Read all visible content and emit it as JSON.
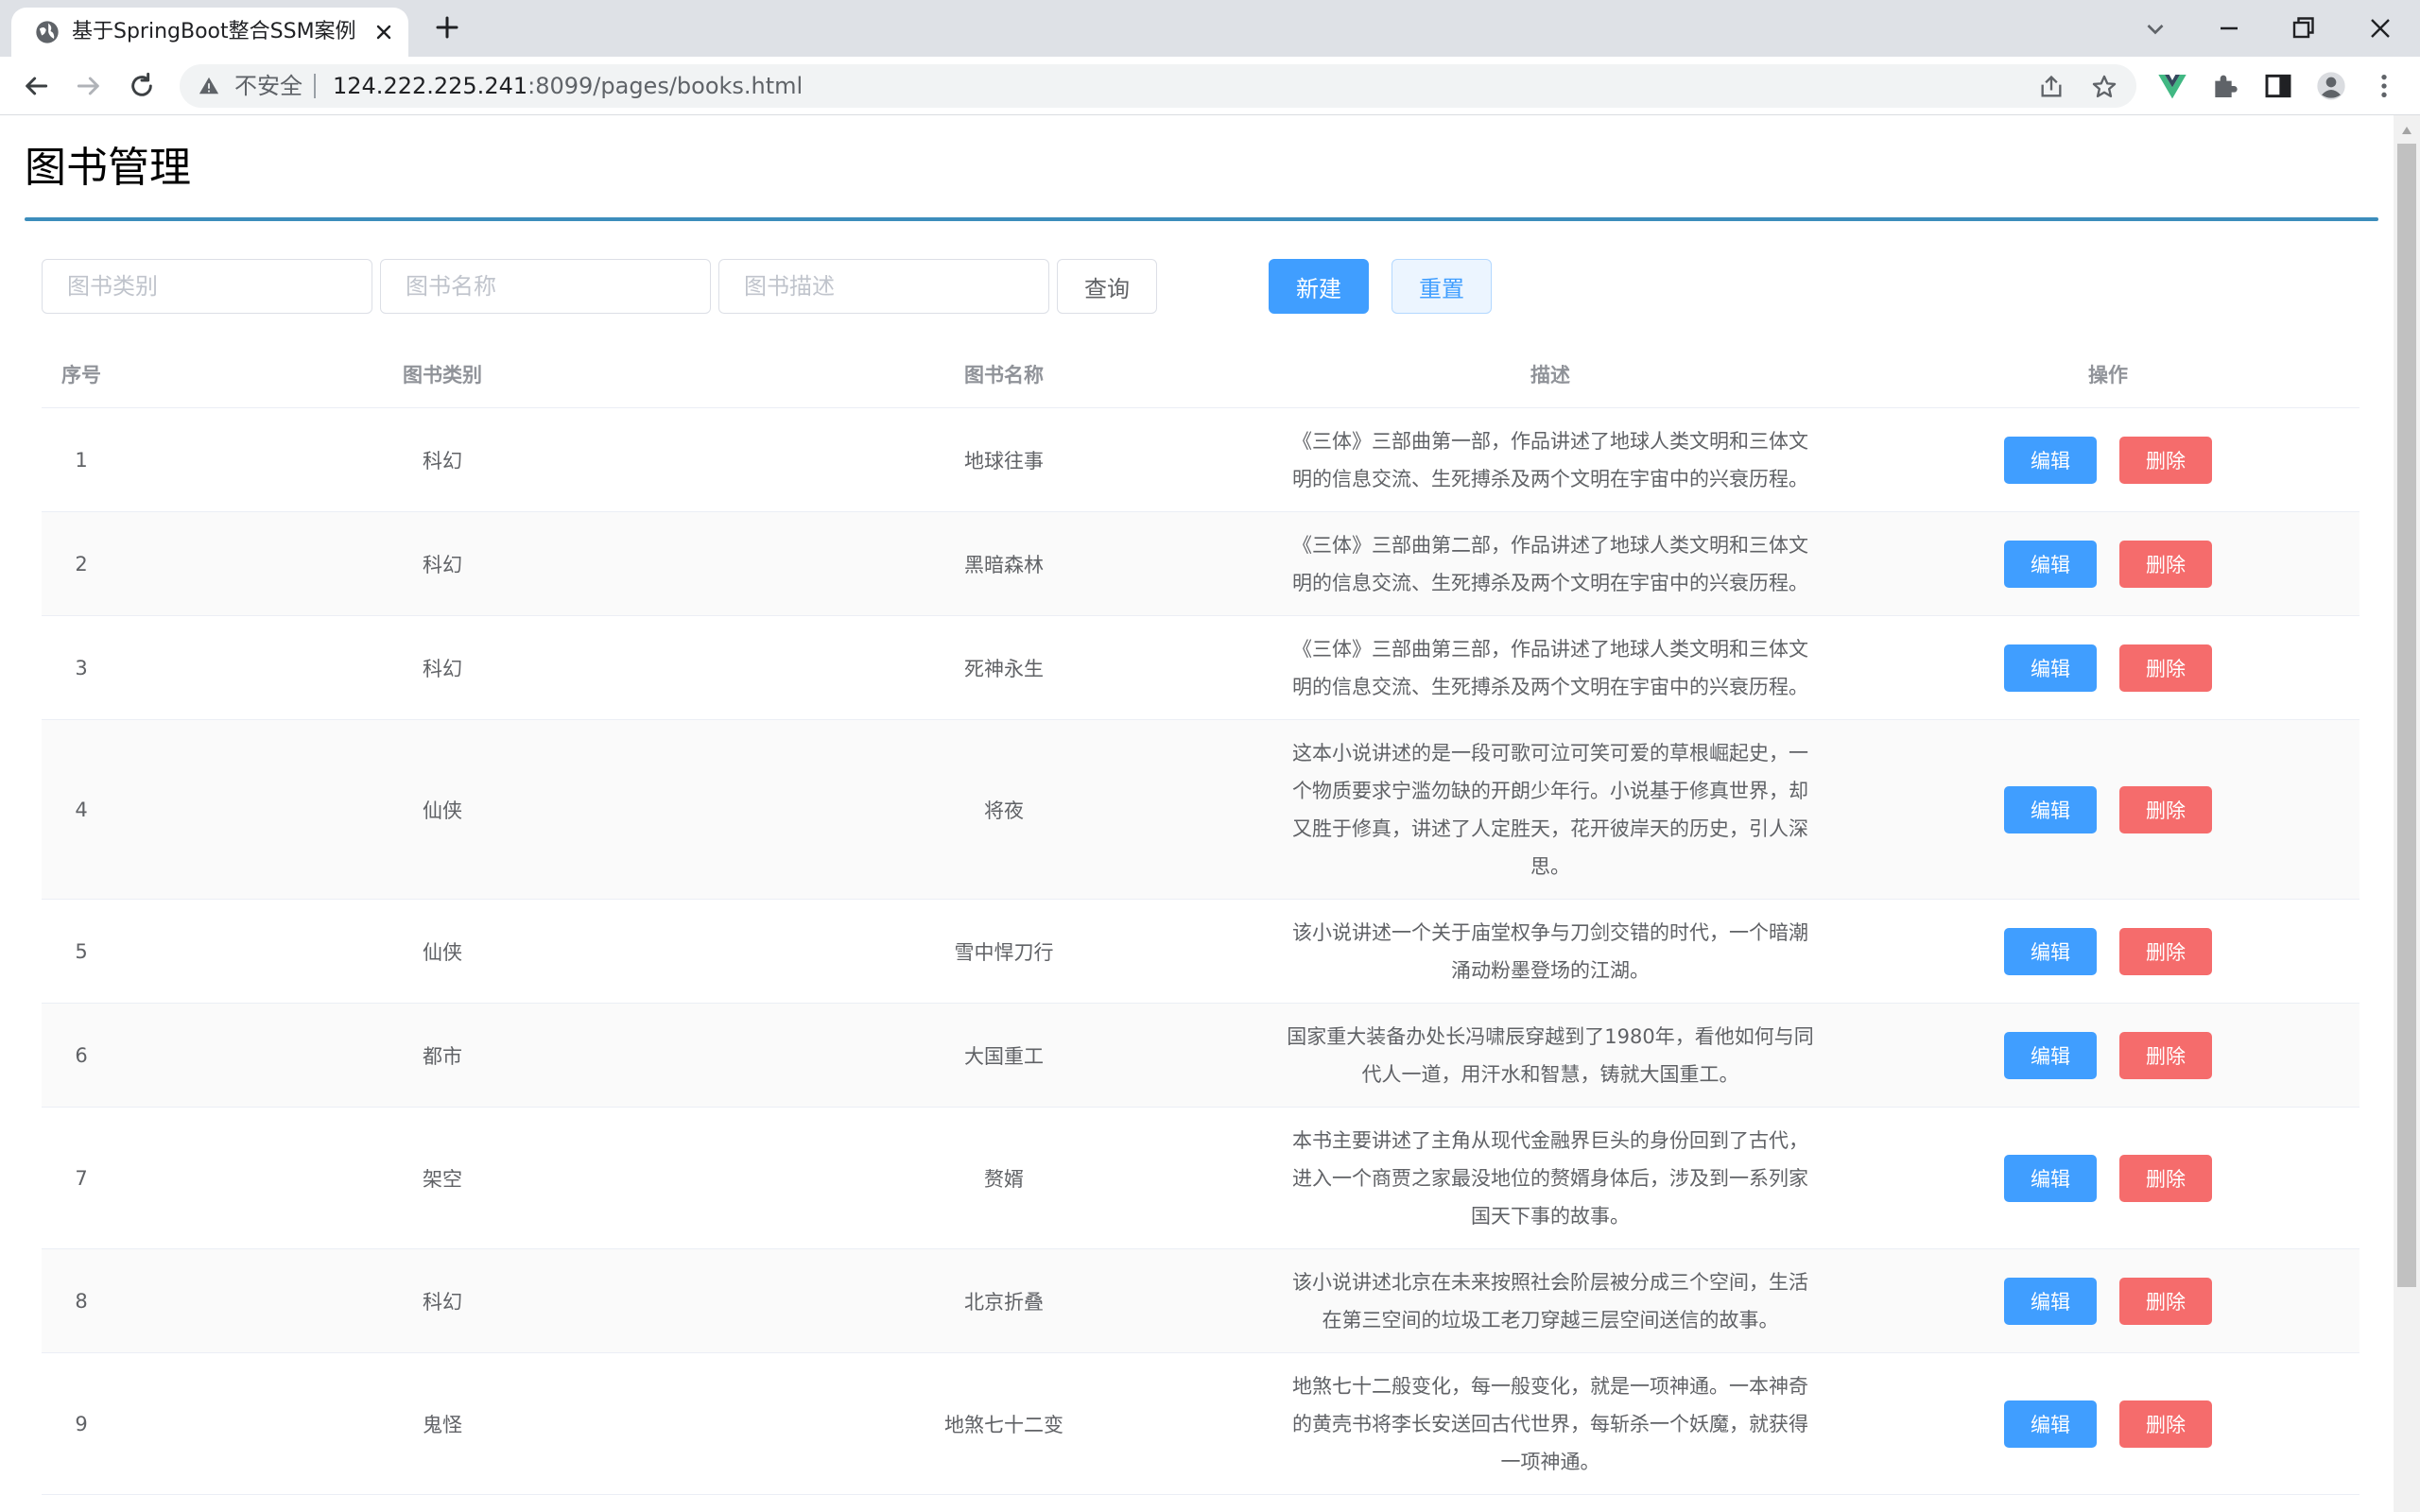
{
  "browser": {
    "tab_title": "基于SpringBoot整合SSM案例",
    "address_insecure": "不安全",
    "address_host": "124.222.225.241",
    "address_path": ":8099/pages/books.html"
  },
  "page": {
    "title": "图书管理"
  },
  "search": {
    "category_placeholder": "图书类别",
    "name_placeholder": "图书名称",
    "desc_placeholder": "图书描述",
    "query_label": "查询",
    "new_label": "新建",
    "reset_label": "重置"
  },
  "table": {
    "headers": [
      "序号",
      "图书类别",
      "图书名称",
      "描述",
      "操作"
    ],
    "edit_label": "编辑",
    "delete_label": "删除",
    "rows": [
      {
        "idx": "1",
        "category": "科幻",
        "name": "地球往事",
        "desc": "《三体》三部曲第一部，作品讲述了地球人类文明和三体文明的信息交流、生死搏杀及两个文明在宇宙中的兴衰历程。"
      },
      {
        "idx": "2",
        "category": "科幻",
        "name": "黑暗森林",
        "desc": "《三体》三部曲第二部，作品讲述了地球人类文明和三体文明的信息交流、生死搏杀及两个文明在宇宙中的兴衰历程。"
      },
      {
        "idx": "3",
        "category": "科幻",
        "name": "死神永生",
        "desc": "《三体》三部曲第三部，作品讲述了地球人类文明和三体文明的信息交流、生死搏杀及两个文明在宇宙中的兴衰历程。"
      },
      {
        "idx": "4",
        "category": "仙侠",
        "name": "将夜",
        "desc": "这本小说讲述的是一段可歌可泣可笑可爱的草根崛起史，一个物质要求宁滥勿缺的开朗少年行。小说基于修真世界，却又胜于修真，讲述了人定胜天，花开彼岸天的历史，引人深思。"
      },
      {
        "idx": "5",
        "category": "仙侠",
        "name": "雪中悍刀行",
        "desc": "该小说讲述一个关于庙堂权争与刀剑交错的时代，一个暗潮涌动粉墨登场的江湖。"
      },
      {
        "idx": "6",
        "category": "都市",
        "name": "大国重工",
        "desc": "国家重大装备办处长冯啸辰穿越到了1980年，看他如何与同代人一道，用汗水和智慧，铸就大国重工。"
      },
      {
        "idx": "7",
        "category": "架空",
        "name": "赘婿",
        "desc": "本书主要讲述了主角从现代金融界巨头的身份回到了古代，进入一个商贾之家最没地位的赘婿身体后，涉及到一系列家国天下事的故事。"
      },
      {
        "idx": "8",
        "category": "科幻",
        "name": "北京折叠",
        "desc": "该小说讲述北京在未来按照社会阶层被分成三个空间，生活在第三空间的垃圾工老刀穿越三层空间送信的故事。"
      },
      {
        "idx": "9",
        "category": "鬼怪",
        "name": "地煞七十二变",
        "desc": "地煞七十二般变化，每一般变化，就是一项神通。一本神奇的黄壳书将李长安送回古代世界，每斩杀一个妖魔，就获得一项神通。"
      }
    ]
  }
}
